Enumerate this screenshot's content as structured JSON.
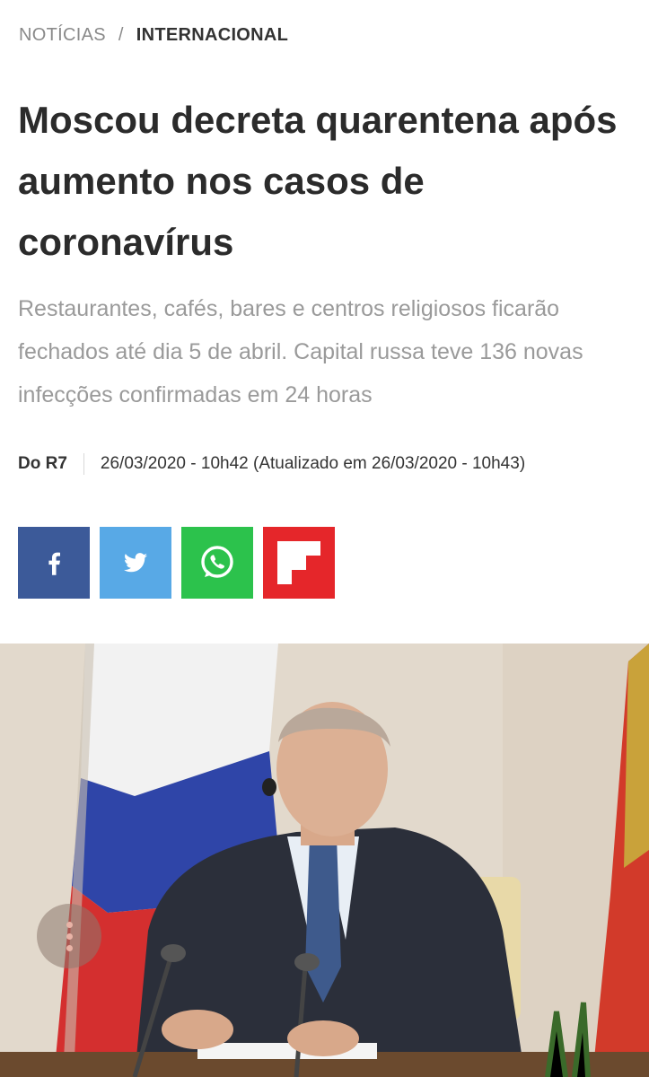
{
  "breadcrumb": {
    "section": "NOTÍCIAS",
    "separator": "/",
    "subsection": "INTERNACIONAL"
  },
  "article": {
    "title": "Moscou decreta quarentena após aumento nos casos de coronavírus",
    "subtitle": "Restaurantes, cafés, bares e centros religiosos ficarão fechados até dia 5 de abril. Capital russa teve 136 novas infecções confirmadas em 24 horas",
    "source": "Do R7",
    "timestamp": "26/03/2020 - 10h42 (Atualizado em 26/03/2020 - 10h43)"
  },
  "share": [
    {
      "name": "facebook",
      "icon": "facebook-icon",
      "color": "#3c5a99"
    },
    {
      "name": "twitter",
      "icon": "twitter-icon",
      "color": "#58a9e6"
    },
    {
      "name": "whatsapp",
      "icon": "whatsapp-icon",
      "color": "#2cc24c"
    },
    {
      "name": "flipboard",
      "icon": "flipboard-icon",
      "color": "#e5262a"
    }
  ],
  "photo": {
    "icon": "more-options-icon"
  }
}
